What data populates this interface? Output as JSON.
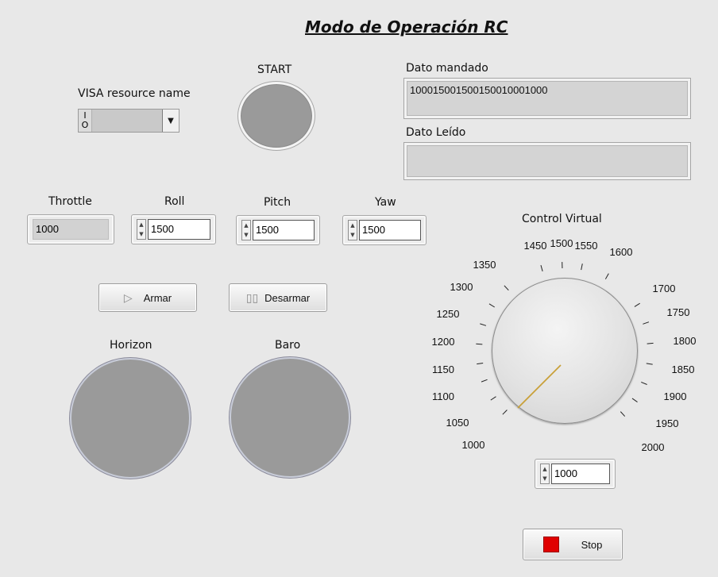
{
  "title": "Modo de Operación RC",
  "visa": {
    "label": "VISA resource name",
    "io_top": "I",
    "io_bottom": "O",
    "value": ""
  },
  "start": {
    "label": "START"
  },
  "dato_mandado": {
    "label": "Dato mandado",
    "value": "10001500150015001000100​0"
  },
  "dato_leido": {
    "label": "Dato Leído",
    "value": ""
  },
  "channels": {
    "throttle": {
      "label": "Throttle",
      "value": "1000"
    },
    "roll": {
      "label": "Roll",
      "value": "1500"
    },
    "pitch": {
      "label": "Pitch",
      "value": "1500"
    },
    "yaw": {
      "label": "Yaw",
      "value": "1500"
    }
  },
  "buttons": {
    "armar": "Armar",
    "desarmar": "Desarmar",
    "stop": "Stop"
  },
  "gauges": {
    "horizon": "Horizon",
    "baro": "Baro"
  },
  "control_virtual": {
    "label": "Control Virtual",
    "value": "1000",
    "scale_min": 1000,
    "scale_max": 2000,
    "ticks": [
      "1000",
      "1050",
      "1100",
      "1150",
      "1200",
      "1250",
      "1300",
      "1350",
      "1450",
      "1500",
      "1550",
      "1600",
      "1700",
      "1750",
      "1800",
      "1850",
      "1900",
      "1950",
      "2000"
    ],
    "needle_color": "#c9a13a"
  },
  "colors": {
    "stop": "#e00000",
    "led_off": "#9a9a9a"
  }
}
